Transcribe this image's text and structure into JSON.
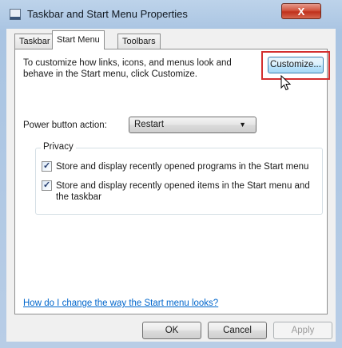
{
  "window": {
    "title": "Taskbar and Start Menu Properties",
    "close_label": "X"
  },
  "tabs": [
    {
      "label": "Taskbar",
      "active": false
    },
    {
      "label": "Start Menu",
      "active": true
    },
    {
      "label": "Toolbars",
      "active": false
    }
  ],
  "start_menu": {
    "description": "To customize how links, icons, and menus look and behave in the Start menu, click Customize.",
    "customize_label": "Customize...",
    "power_label": "Power button action:",
    "power_value": "Restart",
    "privacy_legend": "Privacy",
    "privacy_items": [
      {
        "label": "Store and display recently opened programs in the Start menu",
        "checked": true
      },
      {
        "label": "Store and display recently opened items in the Start menu and the taskbar",
        "checked": true
      }
    ],
    "help_link": "How do I change the way the Start menu looks?"
  },
  "buttons": {
    "ok": "OK",
    "cancel": "Cancel",
    "apply": "Apply"
  },
  "colors": {
    "highlight_box": "#d32f2f",
    "link": "#0066cc",
    "close_button": "#c0301b"
  }
}
